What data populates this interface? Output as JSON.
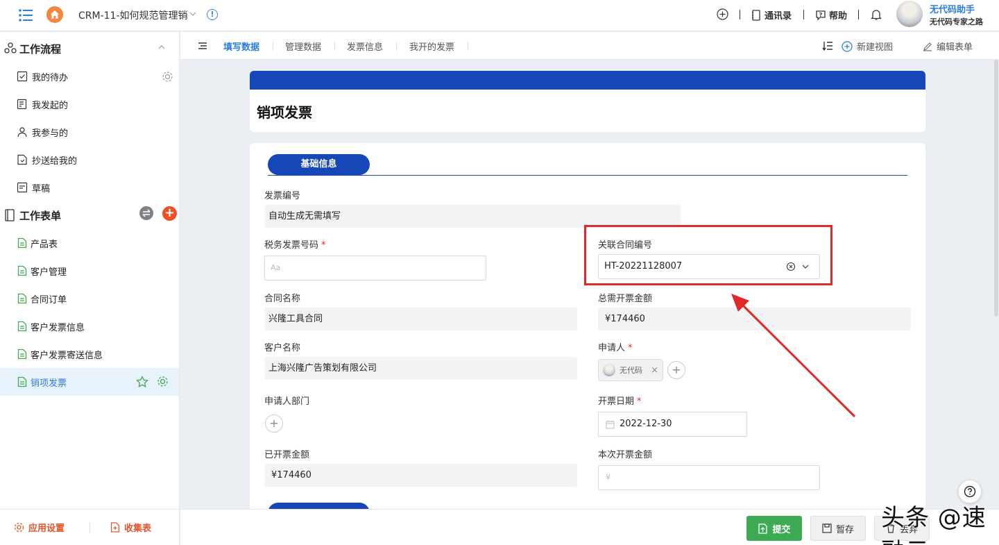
{
  "topbar": {
    "app_title": "CRM-11-如何规范管理销",
    "contacts_label": "通讯录",
    "help_label": "帮助",
    "user_name": "无代码助手",
    "user_subtitle": "无代码专家之路"
  },
  "sidebar": {
    "workflow_title": "工作流程",
    "workflow_items": [
      {
        "label": "我的待办",
        "icon": "checkbox-icon"
      },
      {
        "label": "我发起的",
        "icon": "send-list-icon"
      },
      {
        "label": "我参与的",
        "icon": "person-icon"
      },
      {
        "label": "抄送给我的",
        "icon": "cc-doc-icon"
      },
      {
        "label": "草稿",
        "icon": "draft-icon"
      }
    ],
    "forms_title": "工作表单",
    "form_items": [
      {
        "label": "产品表"
      },
      {
        "label": "客户管理"
      },
      {
        "label": "合同订单"
      },
      {
        "label": "客户发票信息"
      },
      {
        "label": "客户发票寄送信息"
      },
      {
        "label": "销项发票"
      }
    ],
    "footer": {
      "app_settings": "应用设置",
      "collect_form": "收集表"
    }
  },
  "tabs": {
    "items": [
      "填写数据",
      "管理数据",
      "发票信息",
      "我开的发票"
    ],
    "active_index": 0,
    "new_view": "新建视图",
    "edit_form": "编辑表单"
  },
  "form": {
    "title": "销项发票",
    "section_basic": "基础信息",
    "fields": {
      "invoice_no": {
        "label": "发票编号",
        "value": "自动生成无需填写"
      },
      "tax_invoice_no": {
        "label": "税务发票号码",
        "required": "*",
        "placeholder": "Aa"
      },
      "contract_no": {
        "label": "关联合同编号",
        "value": "HT-20221128007"
      },
      "contract_name": {
        "label": "合同名称",
        "value": "兴隆工具合同"
      },
      "total_amount": {
        "label": "总需开票金额",
        "value": "¥174460"
      },
      "customer_name": {
        "label": "客户名称",
        "value": "上海兴隆广告策划有限公司"
      },
      "applicant": {
        "label": "申请人",
        "required": "*",
        "chip": "无代码"
      },
      "applicant_dept": {
        "label": "申请人部门"
      },
      "invoice_date": {
        "label": "开票日期",
        "required": "*",
        "value": "2022-12-30"
      },
      "invoiced_amount": {
        "label": "已开票金额",
        "value": "¥174460"
      },
      "this_amount": {
        "label": "本次开票金额",
        "placeholder": "¥"
      }
    }
  },
  "bottom": {
    "submit": "提交",
    "save_draft": "暂存",
    "discard": "丢弃"
  },
  "watermark": "头条 @速融云",
  "colors": {
    "brand_blue": "#1547b8",
    "accent": "#2b7de0",
    "submit_green": "#3cab54",
    "highlight_red": "#e32828"
  }
}
